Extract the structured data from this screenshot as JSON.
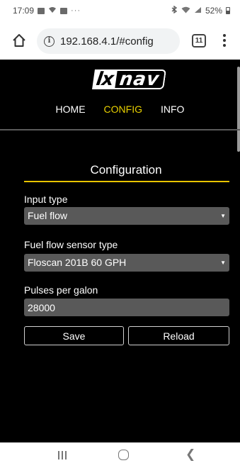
{
  "status_bar": {
    "time": "17:09",
    "dots": "···",
    "battery": "52%"
  },
  "browser": {
    "url": "192.168.4.1/#config",
    "tab_count": "11"
  },
  "site": {
    "logo_left": "lx",
    "logo_right": "nav",
    "nav": {
      "home": "HOME",
      "config": "CONFIG",
      "info": "INFO"
    }
  },
  "config": {
    "title": "Configuration",
    "input_type_label": "Input type",
    "input_type_value": "Fuel flow",
    "sensor_type_label": "Fuel flow sensor type",
    "sensor_type_value": "Floscan 201B 60 GPH",
    "pulses_label": "Pulses per galon",
    "pulses_value": "28000",
    "save_label": "Save",
    "reload_label": "Reload"
  },
  "colors": {
    "page_background": "#000000",
    "accent": "#e8c400",
    "field_background": "#595959"
  }
}
